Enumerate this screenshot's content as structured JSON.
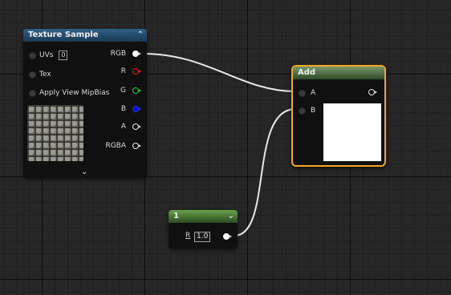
{
  "texture_sample": {
    "title": "Texture Sample",
    "inputs": [
      {
        "label": "UVs",
        "value": "0"
      },
      {
        "label": "Tex"
      },
      {
        "label": "Apply View MipBias"
      }
    ],
    "outputs": [
      "RGB",
      "R",
      "G",
      "B",
      "A",
      "RGBA"
    ]
  },
  "add_node": {
    "title": "Add",
    "inputs": [
      "A",
      "B"
    ]
  },
  "constant_node": {
    "title": "1",
    "param_label": "R",
    "value": "1.0"
  },
  "colors": {
    "selection": "#f5a623",
    "texture_header": "#2f5f86",
    "add_header": "#7a9a6a",
    "constant_header": "#6aa24a"
  },
  "icons": [
    "collapse-chevron-icon",
    "expand-chevron-icon",
    "pin-icon"
  ]
}
